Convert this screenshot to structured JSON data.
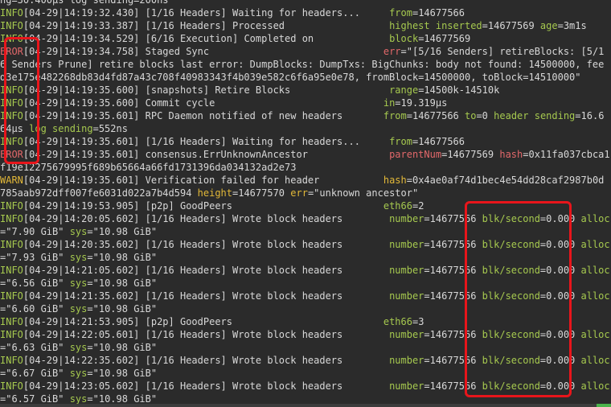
{
  "terminal": {
    "lines": [
      [
        [
          "t",
          "ng=30.400µs log sending=200ns"
        ]
      ],
      [
        [
          "g",
          "INFO"
        ],
        [
          "t",
          "[04-29|14:19:32.430] [1/16 Headers] Waiting for headers...     "
        ],
        [
          "g",
          "from"
        ],
        [
          "t",
          "=14677566"
        ]
      ],
      [
        [
          "g",
          "INFO"
        ],
        [
          "t",
          "[04-29|14:19:33.387] [1/16 Headers] Processed                  "
        ],
        [
          "g",
          "highest inserted"
        ],
        [
          "t",
          "=14677569 "
        ],
        [
          "g",
          "age"
        ],
        [
          "t",
          "=3m1s"
        ]
      ],
      [
        [
          "g",
          "INFO"
        ],
        [
          "t",
          "[04-29|14:19:34.529] [6/16 Execution] Completed on             "
        ],
        [
          "g",
          "block"
        ],
        [
          "t",
          "=14677569"
        ]
      ],
      [
        [
          "r",
          "EROR"
        ],
        [
          "t",
          "[04-29|14:19:34.758] Staged Sync                              "
        ],
        [
          "r",
          "err"
        ],
        [
          "t",
          "=\"[5/16 Senders] retireBlocks: [5/1"
        ]
      ],
      [
        [
          "t",
          "6 Senders Prune] retire blocks last error: DumpBlocks: DumpTxs: BigChunks: body not found: 14500000, fee"
        ]
      ],
      [
        [
          "t",
          "d3e175e482268db83d4fd87a43c708f40983343f4b039e582c6f6a95e0e78, fromBlock=14500000, toBlock=14510000\""
        ]
      ],
      [
        [
          "g",
          "INFO"
        ],
        [
          "t",
          "[04-29|14:19:35.600] [snapshots] Retire Blocks                 "
        ],
        [
          "g",
          "range"
        ],
        [
          "t",
          "=14500k-14510k"
        ]
      ],
      [
        [
          "g",
          "INFO"
        ],
        [
          "t",
          "[04-29|14:19:35.600] Commit cycle                             "
        ],
        [
          "g",
          "in"
        ],
        [
          "t",
          "=19.319µs"
        ]
      ],
      [
        [
          "g",
          "INFO"
        ],
        [
          "t",
          "[04-29|14:19:35.601] RPC Daemon notified of new headers       "
        ],
        [
          "g",
          "from"
        ],
        [
          "t",
          "=14677566 "
        ],
        [
          "g",
          "to"
        ],
        [
          "t",
          "=0 "
        ],
        [
          "g",
          "header sending"
        ],
        [
          "t",
          "=16.6"
        ]
      ],
      [
        [
          "t",
          "64µs "
        ],
        [
          "g",
          "log sending"
        ],
        [
          "t",
          "=552ns"
        ]
      ],
      [
        [
          "g",
          "INFO"
        ],
        [
          "t",
          "[04-29|14:19:35.601] [1/16 Headers] Waiting for headers...     "
        ],
        [
          "g",
          "from"
        ],
        [
          "t",
          "=14677566"
        ]
      ],
      [
        [
          "r",
          "EROR"
        ],
        [
          "t",
          "[04-29|14:19:35.601] consensus.ErrUnknownAncestor              "
        ],
        [
          "r",
          "parentNum"
        ],
        [
          "t",
          "=14677569 "
        ],
        [
          "r",
          "hash"
        ],
        [
          "t",
          "=0x11fa037cbca1"
        ]
      ],
      [
        [
          "t",
          "f19e12275679995f689b65664a66fd1731396da034132ad2e73"
        ]
      ],
      [
        [
          "y",
          "WARN"
        ],
        [
          "t",
          "[04-29|14:19:35.601] Verification failed for header           "
        ],
        [
          "y",
          "hash"
        ],
        [
          "t",
          "=0x4ae0af74d1bec4e54dd28caf2987b0d"
        ]
      ],
      [
        [
          "t",
          "785aab972dff007fe6031d022a7b4d594 "
        ],
        [
          "y",
          "height"
        ],
        [
          "t",
          "=14677570 "
        ],
        [
          "y",
          "err"
        ],
        [
          "t",
          "=\"unknown ancestor\""
        ]
      ],
      [
        [
          "g",
          "INFO"
        ],
        [
          "t",
          "[04-29|14:19:53.905] [p2p] GoodPeers                          "
        ],
        [
          "g",
          "eth66"
        ],
        [
          "t",
          "=2"
        ]
      ],
      [
        [
          "g",
          "INFO"
        ],
        [
          "t",
          "[04-29|14:20:05.602] [1/16 Headers] Wrote block headers        "
        ],
        [
          "g",
          "number"
        ],
        [
          "t",
          "=14677566 "
        ],
        [
          "g",
          "blk/second"
        ],
        [
          "t",
          "=0.000 "
        ],
        [
          "g",
          "alloc"
        ]
      ],
      [
        [
          "t",
          "=\"7.90 GiB\" "
        ],
        [
          "g",
          "sys"
        ],
        [
          "t",
          "=\"10.98 GiB\""
        ]
      ],
      [
        [
          "g",
          "INFO"
        ],
        [
          "t",
          "[04-29|14:20:35.602] [1/16 Headers] Wrote block headers        "
        ],
        [
          "g",
          "number"
        ],
        [
          "t",
          "=14677566 "
        ],
        [
          "g",
          "blk/second"
        ],
        [
          "t",
          "=0.000 "
        ],
        [
          "g",
          "alloc"
        ]
      ],
      [
        [
          "t",
          "=\"7.93 GiB\" "
        ],
        [
          "g",
          "sys"
        ],
        [
          "t",
          "=\"10.98 GiB\""
        ]
      ],
      [
        [
          "g",
          "INFO"
        ],
        [
          "t",
          "[04-29|14:21:05.602] [1/16 Headers] Wrote block headers        "
        ],
        [
          "g",
          "number"
        ],
        [
          "t",
          "=14677566 "
        ],
        [
          "g",
          "blk/second"
        ],
        [
          "t",
          "=0.000 "
        ],
        [
          "g",
          "alloc"
        ]
      ],
      [
        [
          "t",
          "=\"6.56 GiB\" "
        ],
        [
          "g",
          "sys"
        ],
        [
          "t",
          "=\"10.98 GiB\""
        ]
      ],
      [
        [
          "g",
          "INFO"
        ],
        [
          "t",
          "[04-29|14:21:35.602] [1/16 Headers] Wrote block headers        "
        ],
        [
          "g",
          "number"
        ],
        [
          "t",
          "=14677566 "
        ],
        [
          "g",
          "blk/second"
        ],
        [
          "t",
          "=0.000 "
        ],
        [
          "g",
          "alloc"
        ]
      ],
      [
        [
          "t",
          "=\"6.60 GiB\" "
        ],
        [
          "g",
          "sys"
        ],
        [
          "t",
          "=\"10.98 GiB\""
        ]
      ],
      [
        [
          "g",
          "INFO"
        ],
        [
          "t",
          "[04-29|14:21:53.905] [p2p] GoodPeers                          "
        ],
        [
          "g",
          "eth66"
        ],
        [
          "t",
          "=3"
        ]
      ],
      [
        [
          "g",
          "INFO"
        ],
        [
          "t",
          "[04-29|14:22:05.601] [1/16 Headers] Wrote block headers        "
        ],
        [
          "g",
          "number"
        ],
        [
          "t",
          "=14677566 "
        ],
        [
          "g",
          "blk/second"
        ],
        [
          "t",
          "=0.000 "
        ],
        [
          "g",
          "alloc"
        ]
      ],
      [
        [
          "t",
          "=\"6.63 GiB\" "
        ],
        [
          "g",
          "sys"
        ],
        [
          "t",
          "=\"10.98 GiB\""
        ]
      ],
      [
        [
          "g",
          "INFO"
        ],
        [
          "t",
          "[04-29|14:22:35.602] [1/16 Headers] Wrote block headers        "
        ],
        [
          "g",
          "number"
        ],
        [
          "t",
          "=14677566 "
        ],
        [
          "g",
          "blk/second"
        ],
        [
          "t",
          "=0.000 "
        ],
        [
          "g",
          "alloc"
        ]
      ],
      [
        [
          "t",
          "=\"6.67 GiB\" "
        ],
        [
          "g",
          "sys"
        ],
        [
          "t",
          "=\"10.98 GiB\""
        ]
      ],
      [
        [
          "g",
          "INFO"
        ],
        [
          "t",
          "[04-29|14:23:05.602] [1/16 Headers] Wrote block headers        "
        ],
        [
          "g",
          "number"
        ],
        [
          "t",
          "=14677566 "
        ],
        [
          "g",
          "blk/second"
        ],
        [
          "t",
          "=0.000 "
        ],
        [
          "g",
          "alloc"
        ]
      ],
      [
        [
          "t",
          "=\"6.57 GiB\" "
        ],
        [
          "g",
          "sys"
        ],
        [
          "t",
          "=\"10.98 GiB\""
        ]
      ]
    ]
  },
  "colors": {
    "background": "#2b2b2b",
    "text": "#d8d8d8",
    "info": "#a6c94f",
    "error": "#e2686a",
    "warn": "#e2b838",
    "annotation": "#e8151b",
    "status_accent": "#4bb34b"
  }
}
